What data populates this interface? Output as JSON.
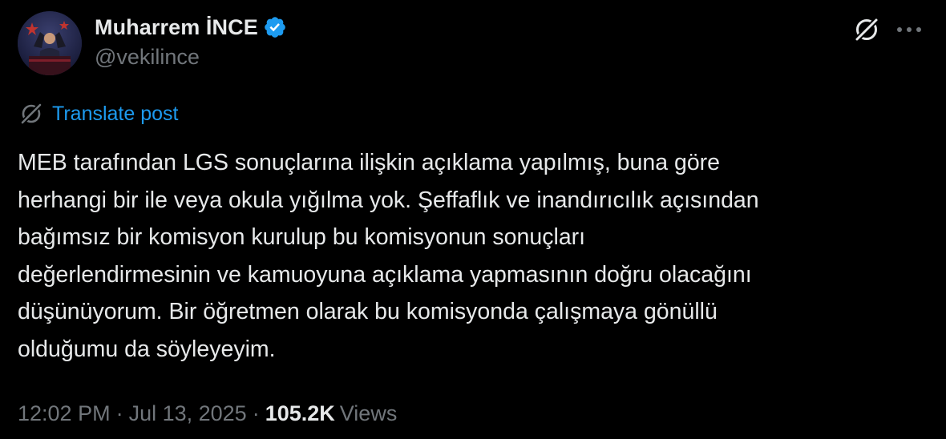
{
  "author": {
    "display_name": "Muharrem İNCE",
    "handle": "@vekilince",
    "verified": true
  },
  "translate": {
    "label": "Translate post"
  },
  "post": {
    "lines": [
      "MEB tarafından LGS sonuçlarına ilişkin açıklama yapılmış, buna göre",
      "herhangi bir ile veya okula yığılma yok. Şeffaflık ve inandırıcılık açısından",
      "bağımsız bir komisyon kurulup bu komisyonun sonuçları",
      "değerlendirmesinin ve kamuoyuna açıklama yapmasının doğru olacağını",
      "düşünüyorum. Bir öğretmen olarak bu komisyonda çalışmaya gönüllü",
      "olduğumu da söyleyeyim."
    ]
  },
  "meta": {
    "time": "12:02 PM",
    "separator": "·",
    "date": "Jul 13, 2025",
    "views_count": "105.2K",
    "views_label": "Views"
  },
  "icons": {
    "verified": "verified-badge-icon",
    "grok": "grok-icon",
    "more": "more-icon",
    "translate": "translate-icon"
  },
  "colors": {
    "background": "#000000",
    "text": "#e7e9ea",
    "muted": "#71767b",
    "accent": "#1d9bf0"
  }
}
